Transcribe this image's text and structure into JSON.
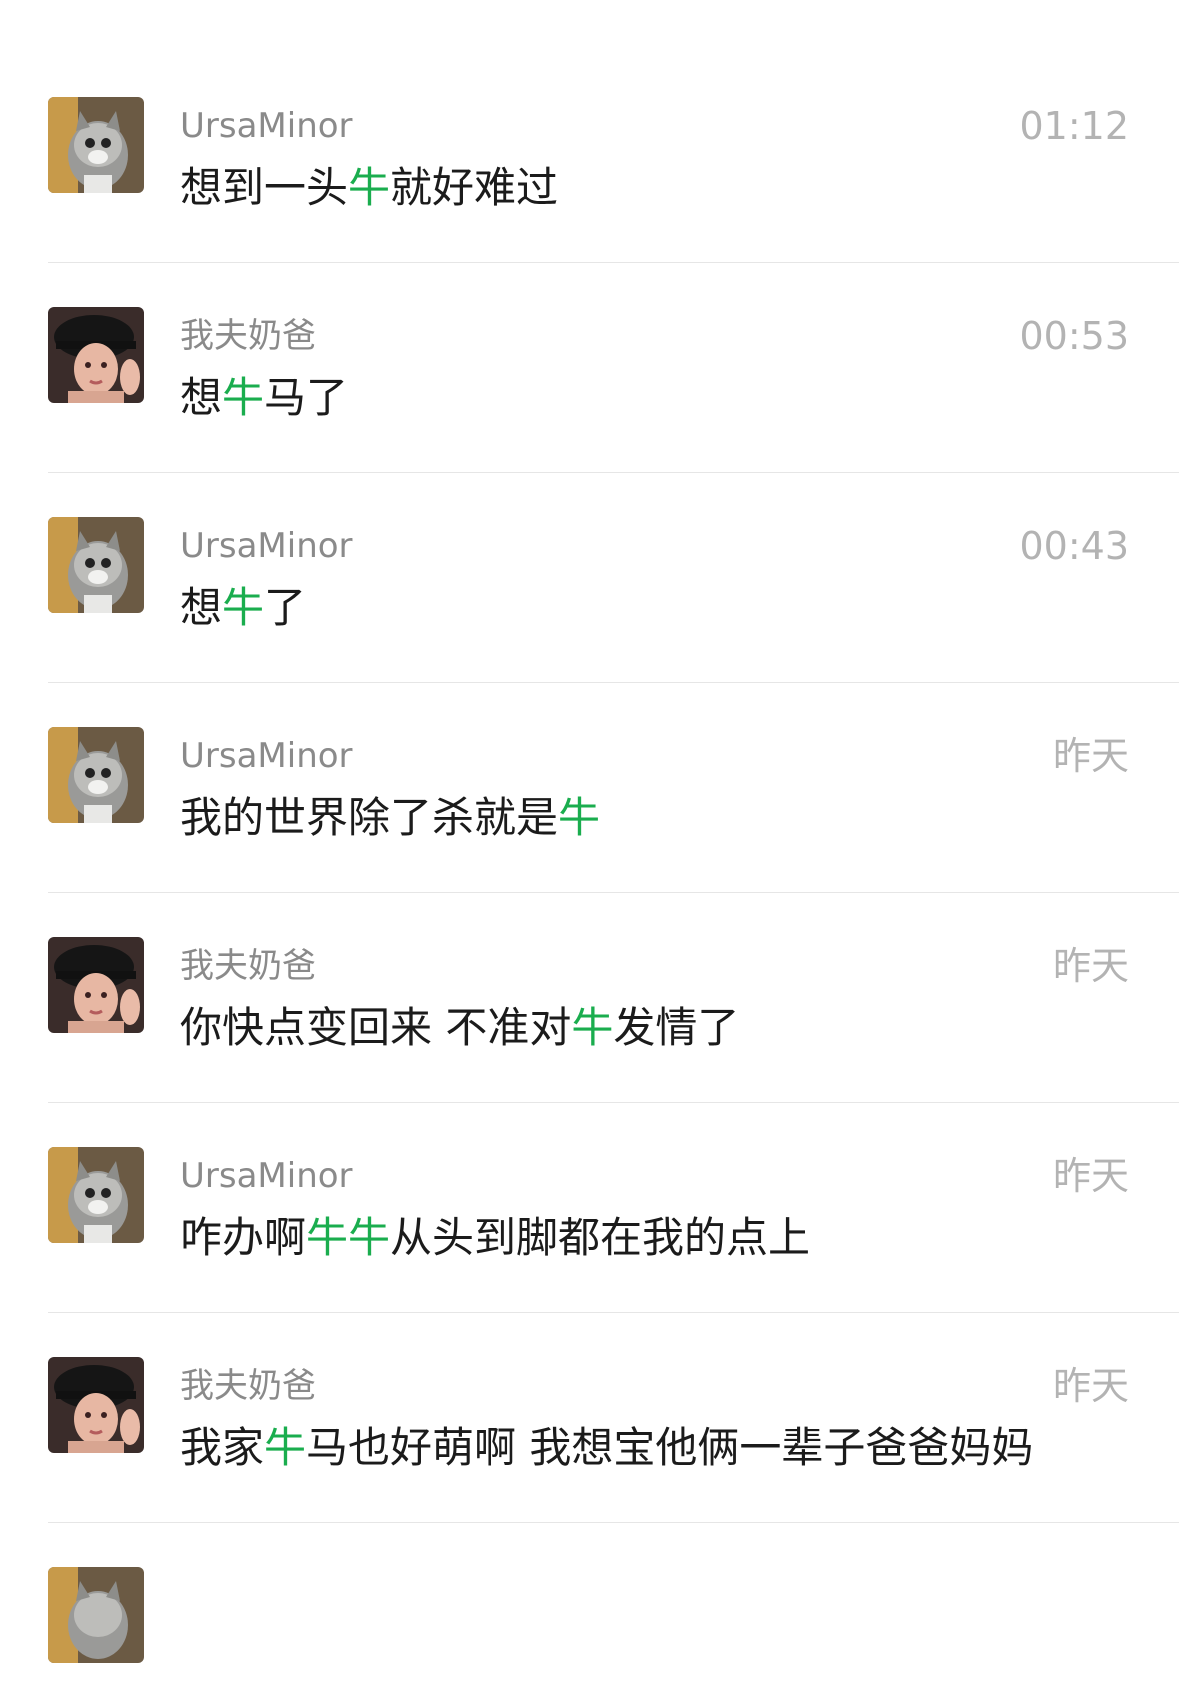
{
  "colors": {
    "highlight": "#1aad4e",
    "name": "#8a8a8a",
    "time": "#b3b3b3",
    "text": "#1b1b1b",
    "divider": "#e6e6e6"
  },
  "results": [
    {
      "avatar": "cat-avatar",
      "name": "UrsaMinor",
      "time": "01:12",
      "segments": [
        "想到一头",
        "牛",
        "就好难过"
      ]
    },
    {
      "avatar": "girl-avatar",
      "name": "我夫奶爸",
      "time": "00:53",
      "segments": [
        "想",
        "牛",
        "马了"
      ]
    },
    {
      "avatar": "cat-avatar",
      "name": "UrsaMinor",
      "time": "00:43",
      "segments": [
        "想",
        "牛",
        "了"
      ]
    },
    {
      "avatar": "cat-avatar",
      "name": "UrsaMinor",
      "time": "昨天",
      "segments": [
        "我的世界除了杀就是",
        "牛",
        ""
      ]
    },
    {
      "avatar": "girl-avatar",
      "name": "我夫奶爸",
      "time": "昨天",
      "segments": [
        "你快点变回来 不准对",
        "牛",
        "发情了"
      ]
    },
    {
      "avatar": "cat-avatar",
      "name": "UrsaMinor",
      "time": "昨天",
      "segments": [
        "咋办啊",
        "牛牛",
        "从头到脚都在我的点上"
      ]
    },
    {
      "avatar": "girl-avatar",
      "name": "我夫奶爸",
      "time": "昨天",
      "segments": [
        "我家",
        "牛",
        "马也好萌啊 我想宝他俩一辈子爸爸妈妈"
      ]
    }
  ]
}
